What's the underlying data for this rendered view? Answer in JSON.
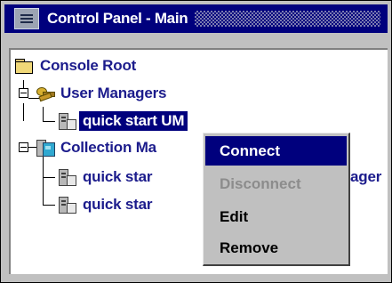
{
  "window": {
    "title": "Control Panel - Main",
    "icon": "control-panel-app-icon"
  },
  "tree": {
    "root": {
      "label": "Console Root",
      "icon": "folder-icon"
    },
    "user_managers": {
      "label": "User Managers",
      "icon": "keys-icon",
      "expanded": true,
      "children": [
        {
          "label": "quick start UM",
          "icon": "server-icon",
          "selected": true
        }
      ]
    },
    "collection_managers": {
      "label": "Collection Ma",
      "icon": "collection-icon",
      "expanded": true,
      "children": [
        {
          "label": "quick star",
          "suffix": "ager",
          "icon": "server-icon"
        },
        {
          "label": "quick star",
          "icon": "server-icon"
        }
      ]
    }
  },
  "context_menu": {
    "items": [
      {
        "label": "Connect",
        "state": "highlighted"
      },
      {
        "label": "Disconnect",
        "state": "disabled"
      },
      {
        "label": "Edit",
        "state": "normal"
      },
      {
        "label": "Remove",
        "state": "normal"
      }
    ]
  },
  "colors": {
    "title_bar": "#00007d",
    "selection": "#00007d",
    "tree_text": "#1c1c8c",
    "disabled_text": "#8c8c8c",
    "face": "#c0c0c0"
  }
}
